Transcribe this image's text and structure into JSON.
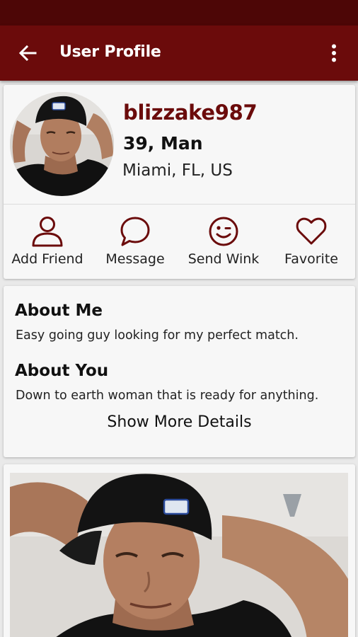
{
  "header": {
    "title": "User Profile",
    "back_icon": "arrow-back-icon",
    "menu_icon": "more-vert-icon"
  },
  "profile": {
    "username": "blizzake987",
    "age_gender": "39, Man",
    "location": "Miami, FL, US"
  },
  "actions": [
    {
      "label": "Add Friend",
      "icon": "person-outline-icon"
    },
    {
      "label": "Message",
      "icon": "chat-bubble-icon"
    },
    {
      "label": "Send Wink",
      "icon": "wink-smiley-icon"
    },
    {
      "label": "Favorite",
      "icon": "heart-outline-icon"
    }
  ],
  "about": {
    "me_heading": "About Me",
    "me_text": "Easy going guy looking for my perfect match.",
    "you_heading": "About You",
    "you_text": "Down to earth woman that is ready for anything.",
    "show_more": "Show More Details"
  },
  "colors": {
    "status_bar": "#4d0606",
    "app_bar": "#6b0b0b",
    "accent": "#6b0b0b",
    "background": "#e9e9e9",
    "card": "#f7f7f7"
  }
}
